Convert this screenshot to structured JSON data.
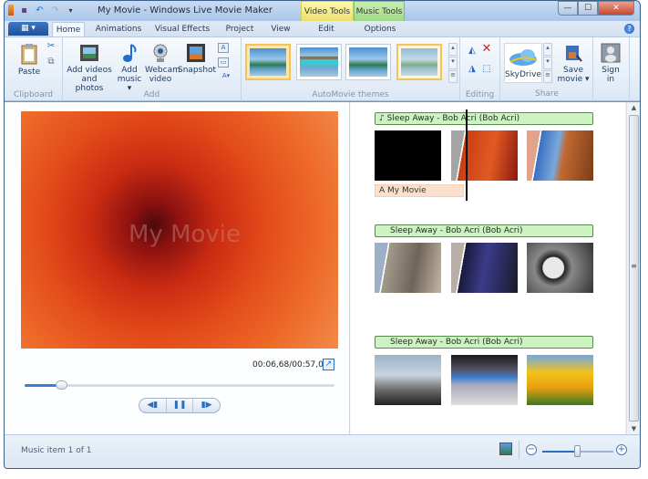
{
  "window": {
    "title": "My Movie - Windows Live Movie Maker",
    "contextual_tabs": {
      "video_tools": "Video Tools",
      "music_tools": "Music Tools"
    },
    "controls": {
      "minimize": "—",
      "maximize": "☐",
      "close": "✕"
    }
  },
  "quick_access": {
    "icons": [
      "app-icon",
      "save-icon",
      "undo-icon",
      "redo-icon",
      "customize-icon"
    ]
  },
  "tabs": [
    {
      "label": "Home",
      "active": true
    },
    {
      "label": "Animations"
    },
    {
      "label": "Visual Effects"
    },
    {
      "label": "Project"
    },
    {
      "label": "View"
    },
    {
      "label": "Edit"
    },
    {
      "label": "Options"
    }
  ],
  "app_menu_label": "▦ ▾",
  "help_label": "?",
  "ribbon": {
    "clipboard": {
      "label": "Clipboard",
      "paste": "Paste"
    },
    "add": {
      "label": "Add",
      "add_videos_line1": "Add videos",
      "add_videos_line2": "and photos",
      "add_music_line1": "Add",
      "add_music_line2": "music ▾",
      "webcam_line1": "Webcam",
      "webcam_line2": "video",
      "snapshot": "Snapshot"
    },
    "themes": {
      "label": "AutoMovie themes",
      "count": 4,
      "selected_index": 0,
      "hover_index": 3
    },
    "editing": {
      "label": "Editing"
    },
    "share": {
      "label": "Share",
      "skydrive": "SkyDrive",
      "save_line1": "Save",
      "save_line2": "movie ▾",
      "sign_line1": "Sign",
      "sign_line2": "in"
    }
  },
  "preview": {
    "watermark": "My Movie",
    "time": "00:06,68/00:57,00",
    "progress_fraction": 0.117,
    "controls": {
      "prev": "◀▮",
      "pause": "❚❚",
      "next": "▮▶"
    }
  },
  "storyboard": {
    "rows": [
      {
        "music": "♪ Sleep Away - Bob Acri (Bob Acri)",
        "caption": "A My Movie",
        "clips": [
          "black-title",
          "flower",
          "desert"
        ]
      },
      {
        "music": "Sleep Away - Bob Acri (Bob Acri)",
        "clips": [
          "koala",
          "softonic",
          "barcelona"
        ]
      },
      {
        "music": "Sleep Away - Bob Acri (Bob Acri)",
        "clips": [
          "bubble-chair",
          "computer-lab",
          "tulips"
        ]
      }
    ]
  },
  "status": {
    "text": "Music item 1 of 1",
    "zoom_fraction": 0.5,
    "zoom_minus": "−",
    "zoom_plus": "+"
  },
  "colors": {
    "accent": "#2a6fc4",
    "music_bar": "#cdf3c2",
    "caption": "#fae0cd"
  }
}
